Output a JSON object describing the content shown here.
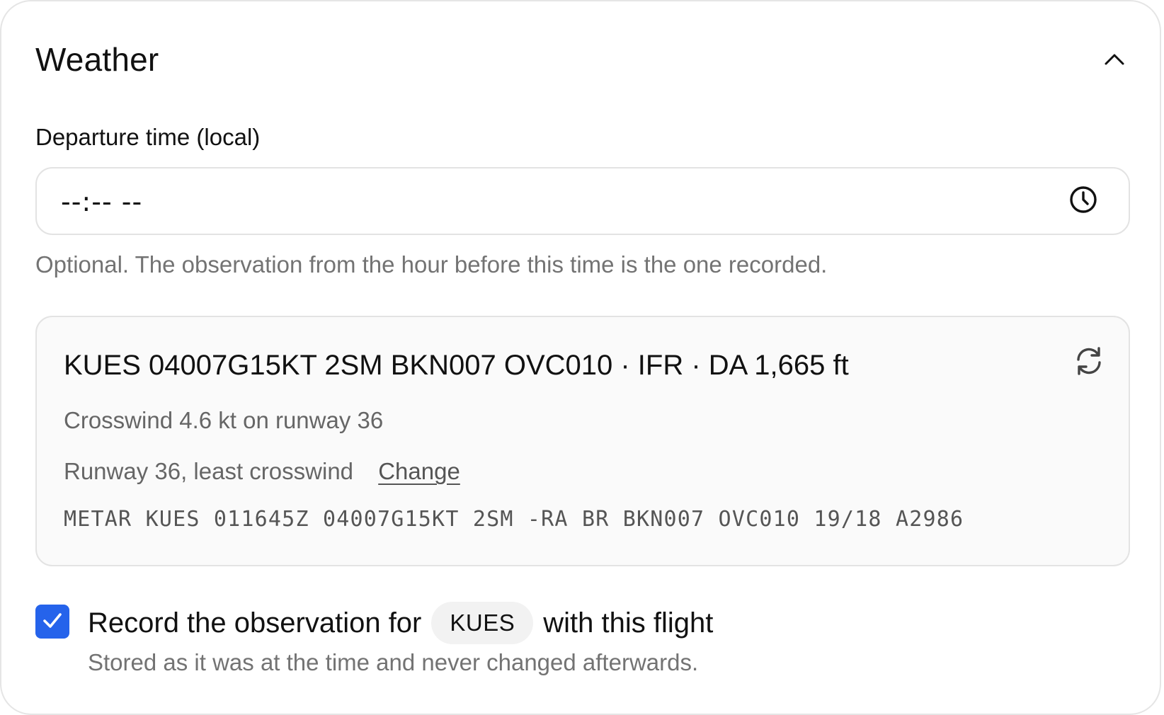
{
  "section": {
    "title": "Weather",
    "collapse_icon": "chevron-up-icon"
  },
  "departure": {
    "label": "Departure time (local)",
    "value": "--:-- --",
    "clock_icon": "clock-icon",
    "hint": "Optional. The observation from the hour before this time is the one recorded."
  },
  "observation": {
    "summary": "KUES 04007G15KT 2SM BKN007 OVC010 · IFR · DA 1,665 ft",
    "refresh_icon": "refresh-icon",
    "crosswind": "Crosswind 4.6 kt on runway 36",
    "runway": "Runway 36, least crosswind",
    "change_label": "Change",
    "metar": "METAR KUES 011645Z 04007G15KT 2SM -RA BR BKN007 OVC010 19/18 A2986"
  },
  "record": {
    "checked": true,
    "text_before": "Record the observation for",
    "station": "KUES",
    "text_after": "with this flight",
    "note": "Stored as it was at the time and never changed afterwards."
  },
  "colors": {
    "accent": "#2563eb",
    "muted_text": "#737373",
    "card_background": "#fafafa",
    "border": "#e3e3e3"
  }
}
